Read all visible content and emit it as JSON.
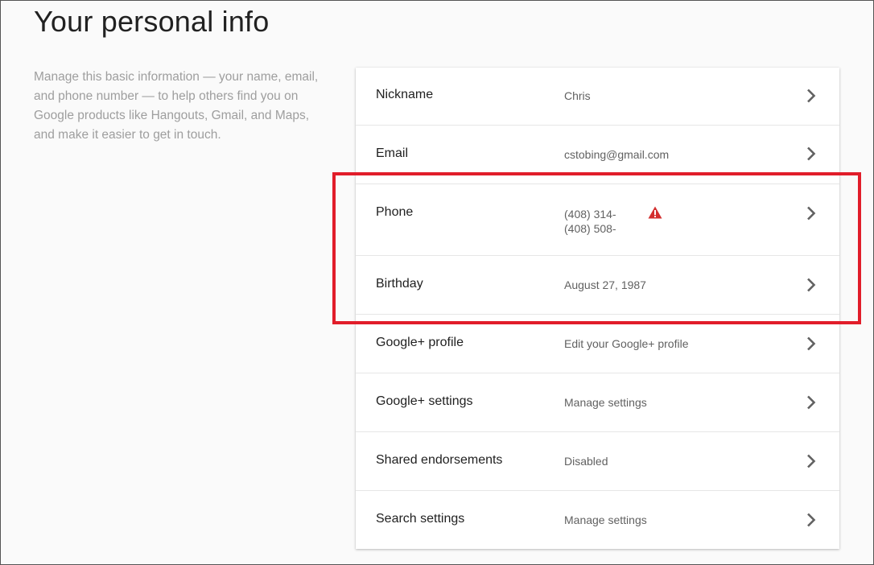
{
  "page": {
    "title": "Your personal info",
    "intro": "Manage this basic information — your name, email, and phone number — to help others find you on Google products like Hangouts, Gmail, and Maps, and make it easier to get in touch."
  },
  "rows": [
    {
      "label": "Nickname",
      "value": "Chris"
    },
    {
      "label": "Email",
      "value": "cstobing@gmail.com"
    },
    {
      "label": "Phone",
      "value_line1": "(408) 314-",
      "value_line2": "(408) 508-",
      "warning_icon": "warning-triangle-icon"
    },
    {
      "label": "Birthday",
      "value": "August 27, 1987"
    },
    {
      "label": "Google+ profile",
      "value": "Edit your Google+ profile"
    },
    {
      "label": "Google+ settings",
      "value": "Manage settings"
    },
    {
      "label": "Shared endorsements",
      "value": "Disabled"
    },
    {
      "label": "Search settings",
      "value": "Manage settings"
    }
  ],
  "icons": {
    "row_arrow": "chevron-right-icon"
  },
  "colors": {
    "highlight": "#e11d2a",
    "warning": "#d32f2f"
  }
}
